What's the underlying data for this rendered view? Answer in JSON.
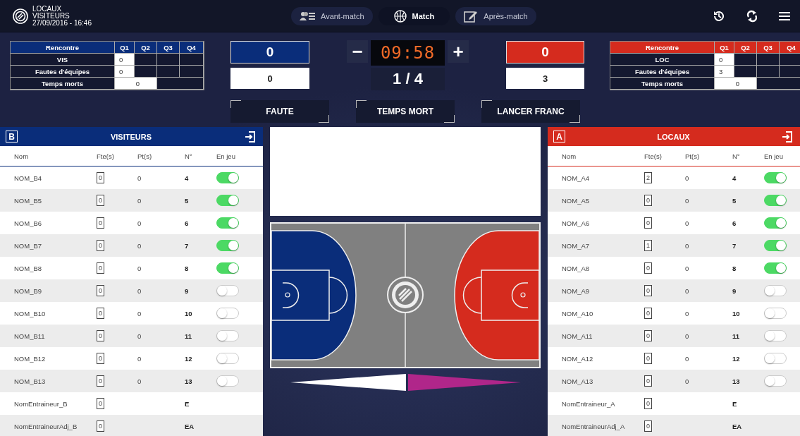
{
  "header": {
    "title_lines": [
      "LOCAUX",
      "VISITEURS",
      "27/09/2016 - 16:46"
    ]
  },
  "nav_tabs": [
    {
      "label": "Avant-match",
      "selected": false
    },
    {
      "label": "Match",
      "selected": true
    },
    {
      "label": "Après-match",
      "selected": false
    }
  ],
  "clock": {
    "minus": "−",
    "time": "09:58",
    "plus": "+",
    "period": "1 / 4"
  },
  "actions": [
    "FAUTE",
    "TEMPS MORT",
    "LANCER FRANC"
  ],
  "teams": [
    {
      "letter": "B",
      "name": "VISITEURS",
      "color": "#0a2d7a",
      "score": "0",
      "team_fouls": "0",
      "stats": {
        "columns": [
          "Rencontre",
          "Q1",
          "Q2",
          "Q3",
          "Q4"
        ],
        "rows": [
          {
            "kind": "quarters",
            "label": "VIS",
            "values": [
              "0"
            ]
          },
          {
            "kind": "quarters",
            "label": "Fautes d'équipes",
            "values": [
              "0"
            ]
          },
          {
            "kind": "timeouts",
            "label": "Temps morts",
            "values": [
              "0"
            ]
          }
        ]
      },
      "columns": [
        "Nom",
        "Fte(s)",
        "Pt(s)",
        "N°",
        "En jeu"
      ],
      "players": [
        {
          "kind": "player",
          "name": "NOM_B4",
          "fouls": "0",
          "points": "0",
          "number": "4",
          "on_court": true
        },
        {
          "kind": "player",
          "name": "NOM_B5",
          "fouls": "0",
          "points": "0",
          "number": "5",
          "on_court": true
        },
        {
          "kind": "player",
          "name": "NOM_B6",
          "fouls": "0",
          "points": "0",
          "number": "6",
          "on_court": true
        },
        {
          "kind": "player",
          "name": "NOM_B7",
          "fouls": "0",
          "points": "0",
          "number": "7",
          "on_court": true
        },
        {
          "kind": "player",
          "name": "NOM_B8",
          "fouls": "0",
          "points": "0",
          "number": "8",
          "on_court": true
        },
        {
          "kind": "player",
          "name": "NOM_B9",
          "fouls": "0",
          "points": "0",
          "number": "9",
          "on_court": false
        },
        {
          "kind": "player",
          "name": "NOM_B10",
          "fouls": "0",
          "points": "0",
          "number": "10",
          "on_court": false
        },
        {
          "kind": "player",
          "name": "NOM_B11",
          "fouls": "0",
          "points": "0",
          "number": "11",
          "on_court": false
        },
        {
          "kind": "player",
          "name": "NOM_B12",
          "fouls": "0",
          "points": "0",
          "number": "12",
          "on_court": false
        },
        {
          "kind": "player",
          "name": "NOM_B13",
          "fouls": "0",
          "points": "0",
          "number": "13",
          "on_court": false
        },
        {
          "kind": "coach",
          "name": "NomEntraineur_B",
          "fouls": "0",
          "number": "E"
        },
        {
          "kind": "coach",
          "name": "NomEntraineurAdj_B",
          "fouls": "0",
          "number": "EA"
        }
      ]
    },
    {
      "letter": "A",
      "name": "LOCAUX",
      "color": "#d52b1e",
      "score": "0",
      "team_fouls": "3",
      "stats": {
        "columns": [
          "Rencontre",
          "Q1",
          "Q2",
          "Q3",
          "Q4"
        ],
        "rows": [
          {
            "kind": "quarters",
            "label": "LOC",
            "values": [
              "0"
            ]
          },
          {
            "kind": "quarters",
            "label": "Fautes d'équipes",
            "values": [
              "3"
            ]
          },
          {
            "kind": "timeouts",
            "label": "Temps morts",
            "values": [
              "0"
            ]
          }
        ]
      },
      "columns": [
        "Nom",
        "Fte(s)",
        "Pt(s)",
        "N°",
        "En jeu"
      ],
      "players": [
        {
          "kind": "player",
          "name": "NOM_A4",
          "fouls": "2",
          "points": "0",
          "number": "4",
          "on_court": true
        },
        {
          "kind": "player",
          "name": "NOM_A5",
          "fouls": "0",
          "points": "0",
          "number": "5",
          "on_court": true
        },
        {
          "kind": "player",
          "name": "NOM_A6",
          "fouls": "0",
          "points": "0",
          "number": "6",
          "on_court": true
        },
        {
          "kind": "player",
          "name": "NOM_A7",
          "fouls": "1",
          "points": "0",
          "number": "7",
          "on_court": true
        },
        {
          "kind": "player",
          "name": "NOM_A8",
          "fouls": "0",
          "points": "0",
          "number": "8",
          "on_court": true
        },
        {
          "kind": "player",
          "name": "NOM_A9",
          "fouls": "0",
          "points": "0",
          "number": "9",
          "on_court": false
        },
        {
          "kind": "player",
          "name": "NOM_A10",
          "fouls": "0",
          "points": "0",
          "number": "10",
          "on_court": false
        },
        {
          "kind": "player",
          "name": "NOM_A11",
          "fouls": "0",
          "points": "0",
          "number": "11",
          "on_court": false
        },
        {
          "kind": "player",
          "name": "NOM_A12",
          "fouls": "0",
          "points": "0",
          "number": "12",
          "on_court": false
        },
        {
          "kind": "player",
          "name": "NOM_A13",
          "fouls": "0",
          "points": "0",
          "number": "13",
          "on_court": false
        },
        {
          "kind": "coach",
          "name": "NomEntraineur_A",
          "fouls": "0",
          "number": "E"
        },
        {
          "kind": "coach",
          "name": "NomEntraineurAdj_A",
          "fouls": "0",
          "number": "EA"
        }
      ]
    }
  ]
}
